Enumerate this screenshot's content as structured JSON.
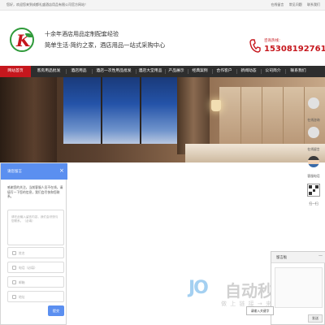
{
  "topbar": {
    "welcome": "您好，欢迎您来到成都礼盛酒店用品有限公司官方网站！",
    "links": [
      "在线留言",
      "常见问题",
      "联系我们"
    ]
  },
  "header": {
    "tagline": "十余年酒店用品定制配套经验",
    "slogan": "简单生活·简约之家，酒店用品一站式采购中心",
    "hotline_label": "咨询热线：",
    "hotline_number": "15308192761",
    "logo_letter": "K"
  },
  "nav": {
    "items": [
      "网站首页",
      "客房用品批发",
      "酒店用品",
      "酒店一次性用品批发",
      "酒店大堂用品",
      "产品展示",
      "经典案例",
      "合作客户",
      "新闻动态",
      "公司简介",
      "联系我们"
    ],
    "active_index": 0
  },
  "float_bar": {
    "items": [
      {
        "label": "在线咨询",
        "icon": "chat-bubble-icon"
      },
      {
        "label": "在线留言",
        "icon": "message-icon"
      },
      {
        "label": "客服电话",
        "icon": "avatar"
      },
      {
        "label": "扫一扫",
        "icon": "qr-code-icon"
      }
    ]
  },
  "chat_popup": {
    "title": "请您留言",
    "close": "×",
    "greeting": "感谢您的关注，当前客服人员不在线，请填写一下您的信息，我们会尽快和您联系。",
    "textarea_placeholder": "请在此输入留言内容，我们会尽快与您联系。（必填）",
    "fields": [
      "姓名",
      "电话（必填）",
      "邮箱",
      "地址"
    ],
    "send": "提交"
  },
  "message_widget": {
    "title": "留言板",
    "minimize": "—",
    "send": "发送"
  },
  "input_prompt": "请输入关键字",
  "watermark": {
    "logo": "JO",
    "title": "自动秒收录",
    "subtitle": "做 上 链 接 → 来 访 一 次 → 自 动 收 录"
  },
  "colors": {
    "brand_red": "#c6171d",
    "nav_bg": "#2e2e2e",
    "chat_blue": "#5b8ff0",
    "logo_green": "#2f9a3a"
  }
}
